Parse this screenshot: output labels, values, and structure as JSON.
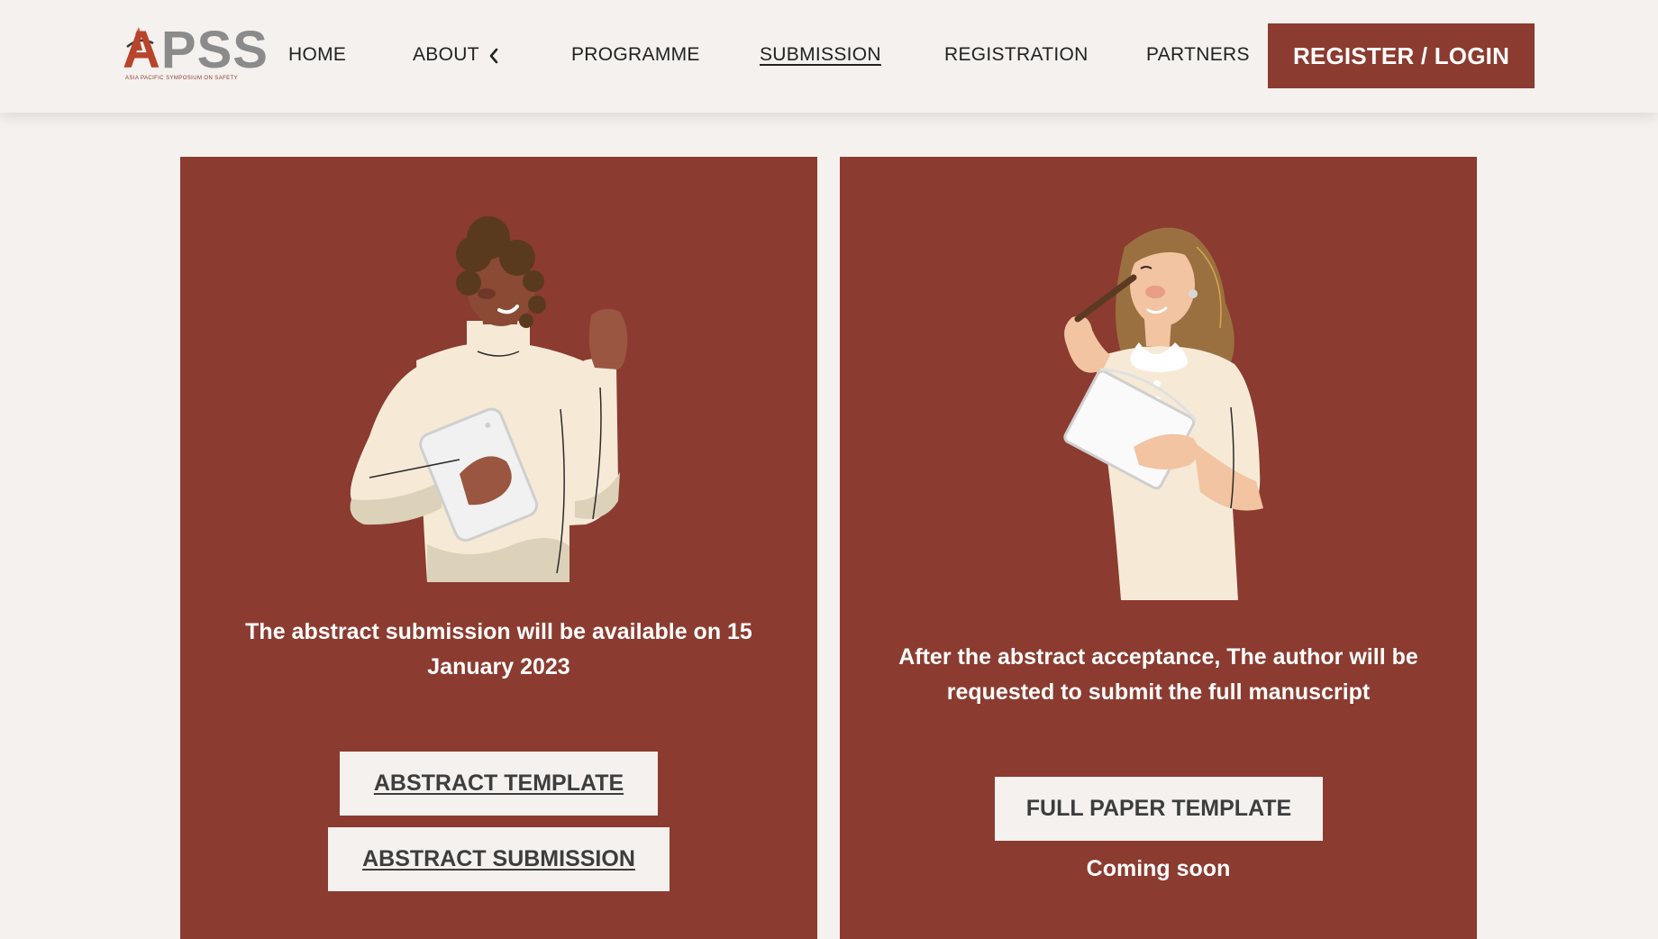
{
  "logo": {
    "letters_first": "A",
    "letters_rest": "PSS",
    "tagline": "ASIA PACIFIC SYMPOSIUM ON SAFETY"
  },
  "nav": {
    "items": [
      {
        "label": "HOME"
      },
      {
        "label": "ABOUT"
      },
      {
        "label": "PROGRAMME"
      },
      {
        "label": "SUBMISSION",
        "active": true
      },
      {
        "label": "REGISTRATION"
      },
      {
        "label": "PARTNERS"
      }
    ],
    "login_label": "REGISTER / LOGIN"
  },
  "abstract_card": {
    "description": "The abstract submission will be available on 15 January 2023",
    "template_button": "ABSTRACT TEMPLATE",
    "submission_button": "ABSTRACT SUBMISSION"
  },
  "paper_card": {
    "description": "After the abstract acceptance, The author will be requested to submit the full manuscript",
    "template_button": "FULL PAPER TEMPLATE",
    "status": "Coming soon"
  },
  "colors": {
    "brand": "#8b3b2f",
    "background": "#f4f1ee",
    "logo_accent": "#b8442c",
    "logo_gray": "#8b8b8b"
  },
  "icons": {
    "about_dropdown": "chevron-left-icon"
  }
}
